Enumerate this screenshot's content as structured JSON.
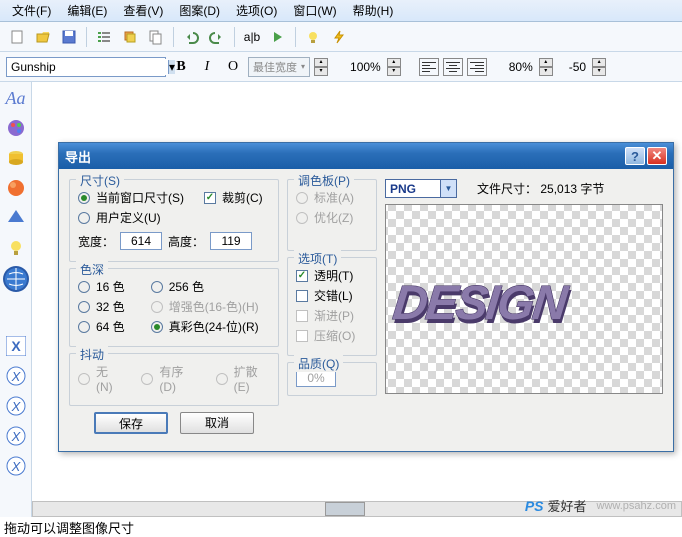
{
  "menu": {
    "file": "文件(F)",
    "edit": "编辑(E)",
    "view": "查看(V)",
    "image": "图案(D)",
    "options": "选项(O)",
    "window": "窗口(W)",
    "help": "帮助(H)"
  },
  "toolbar": {
    "font": "Gunship",
    "width_mode": "最佳宽度",
    "zoom": "100%",
    "opacity": "80%",
    "offset": "-50"
  },
  "dialog": {
    "title": "导出",
    "size_grp": "尺寸(S)",
    "cur_win": "当前窗口尺寸(S)",
    "user_def": "用户定义(U)",
    "crop": "裁剪(C)",
    "width_l": "宽度：",
    "width_v": "614",
    "height_l": "高度：",
    "height_v": "119",
    "depth_grp": "色深",
    "c16": "16 色",
    "c256": "256 色",
    "c32": "32 色",
    "cEnh": "增强色(16-色)(H)",
    "c64": "64 色",
    "cTrue": "真彩色(24-位)(R)",
    "dither_grp": "抖动",
    "d_none": "无(N)",
    "d_ord": "有序(D)",
    "d_diff": "扩散(E)",
    "palette_grp": "调色板(P)",
    "pal_std": "标准(A)",
    "pal_opt": "优化(Z)",
    "opt_grp": "选项(T)",
    "o_trans": "透明(T)",
    "o_inter": "交错(L)",
    "o_prog": "渐进(P)",
    "o_comp": "压缩(O)",
    "qual_grp": "品质(Q)",
    "qual_v": "0%",
    "format": "PNG",
    "filesize_l": "文件尺寸：",
    "filesize_v": "25,013 字节",
    "save": "保存",
    "cancel": "取消"
  },
  "status": "拖动可以调整图像尺寸",
  "watermark": {
    "logo": "PS",
    "cn": "爱好者",
    "url": "www.psahz.com"
  }
}
